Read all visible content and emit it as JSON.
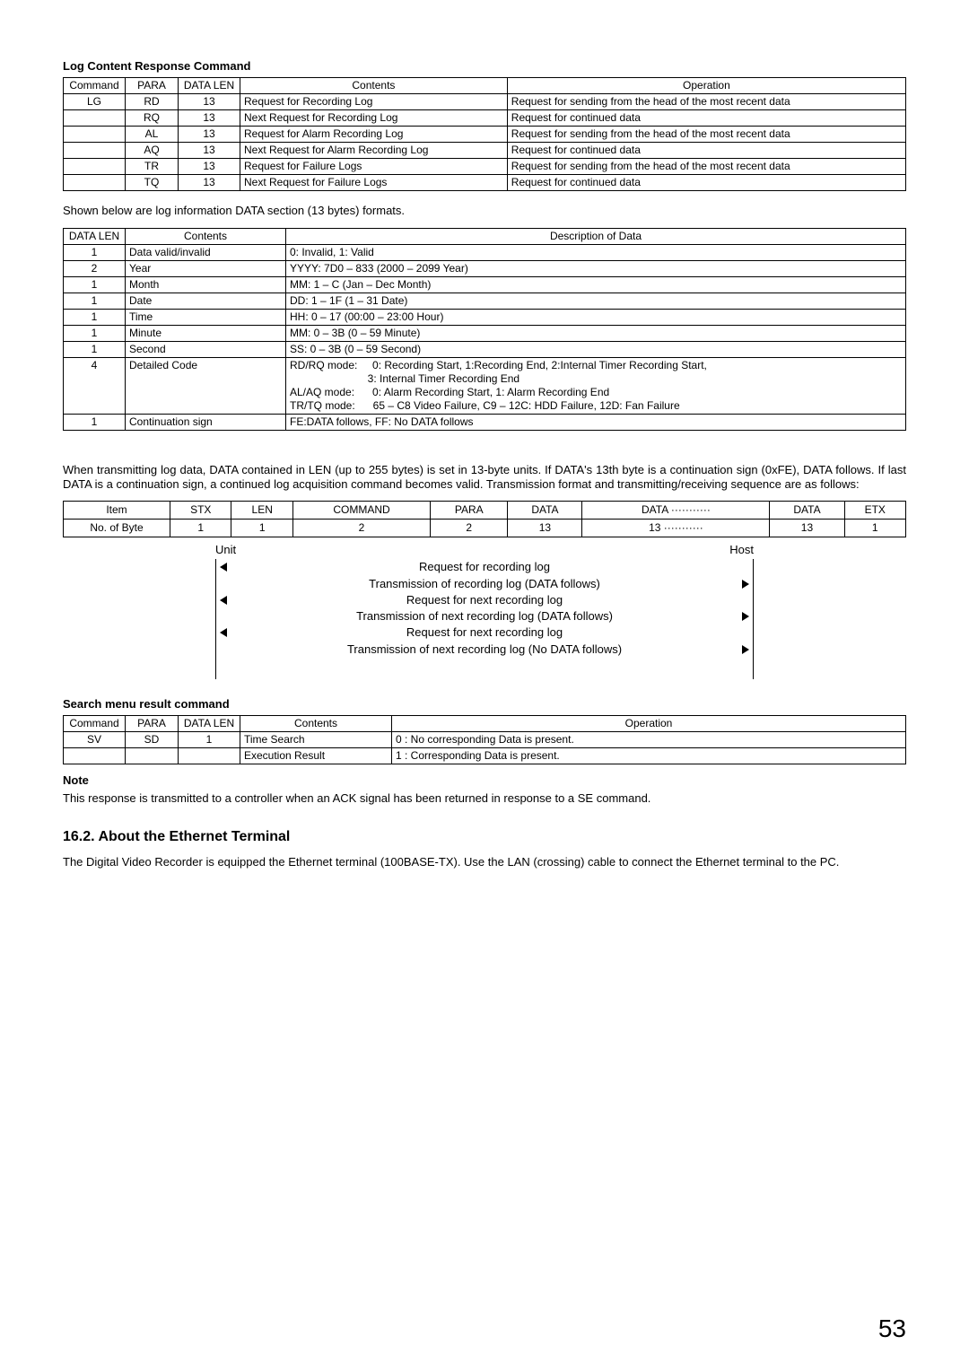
{
  "heading1": "Log Content Response Command",
  "table1": {
    "headers": [
      "Command",
      "PARA",
      "DATA LEN",
      "Contents",
      "Operation"
    ],
    "rows": [
      [
        "LG",
        "RD",
        "13",
        "Request for Recording Log",
        "Request for sending from the head of the most recent data"
      ],
      [
        "",
        "RQ",
        "13",
        "Next Request for Recording Log",
        "Request for continued data"
      ],
      [
        "",
        "AL",
        "13",
        "Request for Alarm Recording Log",
        "Request for sending from the head of the most recent data"
      ],
      [
        "",
        "AQ",
        "13",
        "Next Request for Alarm Recording Log",
        "Request for continued data"
      ],
      [
        "",
        "TR",
        "13",
        "Request for Failure Logs",
        "Request for sending from the head of the most recent data"
      ],
      [
        "",
        "TQ",
        "13",
        "Next Request for  Failure Logs",
        "Request for continued data"
      ]
    ]
  },
  "para1": "Shown below are log information DATA section (13 bytes) formats.",
  "table2": {
    "headers": [
      "DATA LEN",
      "Contents",
      "Description of Data"
    ],
    "rows": [
      [
        "1",
        "Data valid/invalid",
        "0: Invalid, 1: Valid"
      ],
      [
        "2",
        "Year",
        "YYYY: 7D0 – 833 (2000 – 2099 Year)"
      ],
      [
        "1",
        "Month",
        "MM: 1 – C (Jan – Dec Month)"
      ],
      [
        "1",
        "Date",
        "DD: 1 – 1F (1 – 31 Date)"
      ],
      [
        "1",
        "Time",
        "HH: 0 – 17 (00:00 – 23:00 Hour)"
      ],
      [
        "1",
        "Minute",
        "MM: 0 – 3B (0 – 59 Minute)"
      ],
      [
        "1",
        "Second",
        "SS: 0 – 3B (0 – 59 Second)"
      ],
      [
        "4",
        "Detailed Code",
        "RD/RQ mode:     0: Recording Start, 1:Recording End, 2:Internal Timer Recording Start,\n                          3: Internal Timer Recording End\nAL/AQ mode:      0: Alarm Recording Start, 1: Alarm Recording End\nTR/TQ mode:      65 – C8 Video Failure, C9 – 12C: HDD Failure, 12D: Fan Failure"
      ],
      [
        "1",
        "Continuation sign",
        "FE:DATA follows, FF: No DATA follows"
      ]
    ]
  },
  "para2": "When transmitting log data, DATA contained in LEN (up to 255 bytes) is set in 13-byte units. If DATA's 13th byte is a continuation sign (0xFE), DATA follows. If last DATA is a continuation sign, a continued log acquisition command becomes valid. Transmission format and transmitting/receiving sequence are as follows:",
  "packet": {
    "row1": [
      "Item",
      "STX",
      "LEN",
      "COMMAND",
      "PARA",
      "DATA",
      "DATA  ···········",
      "DATA",
      "ETX"
    ],
    "row2": [
      "No. of Byte",
      "1",
      "1",
      "2",
      "2",
      "13",
      "13  ···········",
      "13",
      "1"
    ]
  },
  "seq": {
    "unit": "Unit",
    "host": "Host",
    "rows": [
      {
        "text": "Request for recording log",
        "dir": "left"
      },
      {
        "text": "Transmission of recording log (DATA follows)",
        "dir": "right"
      },
      {
        "text": "Request for next recording log",
        "dir": "left"
      },
      {
        "text": "Transmission of next recording log (DATA follows)",
        "dir": "right"
      },
      {
        "text": "Request for next recording log",
        "dir": "left"
      },
      {
        "text": "Transmission of next recording log (No DATA follows)",
        "dir": "right"
      }
    ]
  },
  "heading2": "Search menu result command",
  "table3": {
    "headers": [
      "Command",
      "PARA",
      "DATA LEN",
      "Contents",
      "Operation"
    ],
    "rows": [
      [
        "SV",
        "SD",
        "1",
        "Time Search",
        "0 : No corresponding Data is present."
      ],
      [
        "",
        "",
        "",
        "Execution Result",
        "1 : Corresponding Data is present."
      ]
    ]
  },
  "noteLabel": "Note",
  "noteText": "This response is transmitted to a controller when an ACK signal has been returned in response to a SE command.",
  "h2": "16.2. About the Ethernet Terminal",
  "para3": "The Digital Video Recorder is equipped the Ethernet terminal (100BASE-TX). Use the LAN (crossing) cable to connect the Ethernet terminal to the PC.",
  "pageNum": "53"
}
